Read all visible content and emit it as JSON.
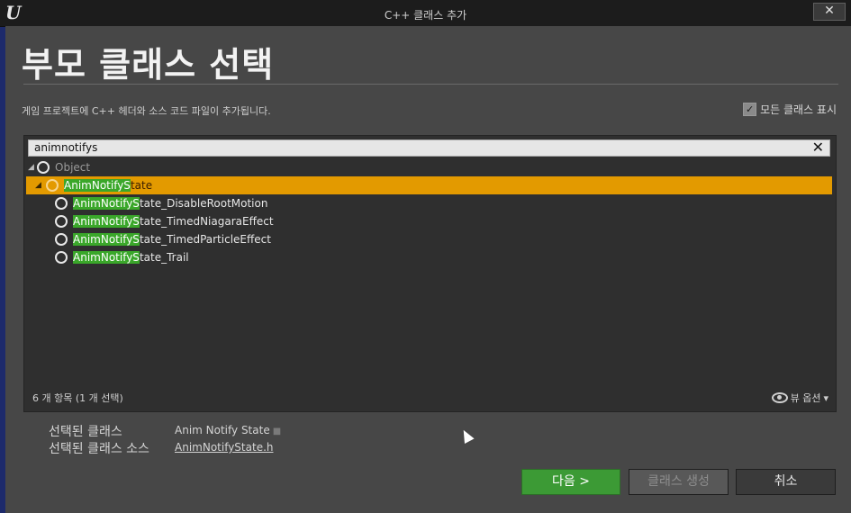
{
  "window": {
    "title": "C++ 클래스 추가",
    "close_glyph": "✕"
  },
  "header": {
    "title": "부모 클래스 선택",
    "description": "게임 프로젝트에 C++ 헤더와 소스 코드 파일이 추가됩니다.",
    "show_all_label": "모든 클래스 표시",
    "show_all_checked": true
  },
  "search": {
    "value": "animnotifys",
    "clear_glyph": "✕"
  },
  "tree": {
    "root": {
      "label": "Object"
    },
    "selected": {
      "hl": "AnimNotifyS",
      "rest": "tate"
    },
    "children": [
      {
        "hl": "AnimNotifyS",
        "rest": "tate_DisableRootMotion"
      },
      {
        "hl": "AnimNotifyS",
        "rest": "tate_TimedNiagaraEffect"
      },
      {
        "hl": "AnimNotifyS",
        "rest": "tate_TimedParticleEffect"
      },
      {
        "hl": "AnimNotifyS",
        "rest": "tate_Trail"
      }
    ]
  },
  "footer": {
    "count": "6 개 항목 (1 개 선택)",
    "view_options": "뷰 옵션"
  },
  "selection": {
    "class_label": "선택된 클래스",
    "class_value": "Anim Notify State",
    "source_label": "선택된 클래스 소스",
    "source_value": "AnimNotifyState.h"
  },
  "buttons": {
    "next": "다음 >",
    "create": "클래스 생성",
    "cancel": "취소"
  },
  "colors": {
    "highlight": "#3aa72a",
    "selected_row": "#e39a00",
    "next_button": "#3c9a35"
  }
}
